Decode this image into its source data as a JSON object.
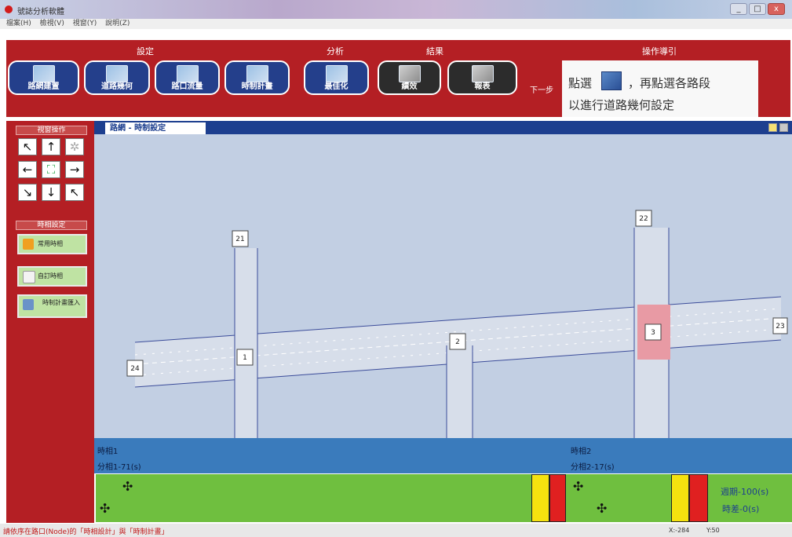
{
  "window": {
    "title": "號誌分析軟體",
    "controls": [
      "_",
      "□",
      "x"
    ]
  },
  "menu": [
    "檔案(H)",
    "檢視(V)",
    "視窗(Y)",
    "說明(Z)"
  ],
  "ribbon": {
    "sections": {
      "setup": "設定",
      "analysis": "分析",
      "result": "結果",
      "guide_title": "操作導引"
    },
    "buttons": {
      "network": "路網建置",
      "geometry": "道路幾何",
      "flow": "路口流量",
      "timing_plan": "時制計畫",
      "optimize": "最佳化",
      "performance": "績效",
      "report": "報表"
    },
    "next_step": "下一步",
    "guide_line1": "點選",
    "guide_line1b": "，再點選各路段",
    "guide_line2": "以進行道路幾何設定"
  },
  "left_panel": {
    "view_ops": "視窗操作",
    "timing_setup": "時相設定",
    "btn_common": "常用時相",
    "btn_custom": "自訂時相",
    "btn_import": "時制計畫匯入"
  },
  "map": {
    "tab_title": "路網 - 時制設定",
    "nodes": [
      "21",
      "22",
      "23",
      "24",
      "1",
      "2",
      "3"
    ]
  },
  "timing": {
    "phase1": "時相1",
    "split1": "分相1-71(s)",
    "phase2": "時相2",
    "split2": "分相2-17(s)",
    "cycle": "週期-100(s)",
    "offset": "時差-0(s)",
    "colors": {
      "green": "#6fbf3f",
      "yellow": "#f5e20f",
      "red": "#e02020"
    }
  },
  "status": {
    "message": "請依序在路口(Node)的「時相設計」與「時制計畫」",
    "x": "X:-284",
    "y": "Y:50"
  }
}
